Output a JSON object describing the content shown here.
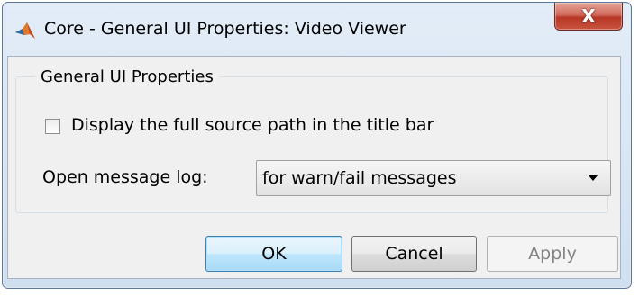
{
  "window": {
    "title": "Core - General UI Properties: Video Viewer",
    "close_glyph": "X"
  },
  "panel": {
    "title": "General UI Properties"
  },
  "checkbox": {
    "label": "Display the full source path in the title bar",
    "checked": false
  },
  "message_log": {
    "label": "Open message log:",
    "selected": "for warn/fail messages"
  },
  "buttons": {
    "ok": "OK",
    "cancel": "Cancel",
    "apply": "Apply",
    "apply_enabled": false
  },
  "icons": {
    "app": "matlab-icon",
    "close": "close-icon",
    "dropdown": "chevron-down-icon"
  }
}
